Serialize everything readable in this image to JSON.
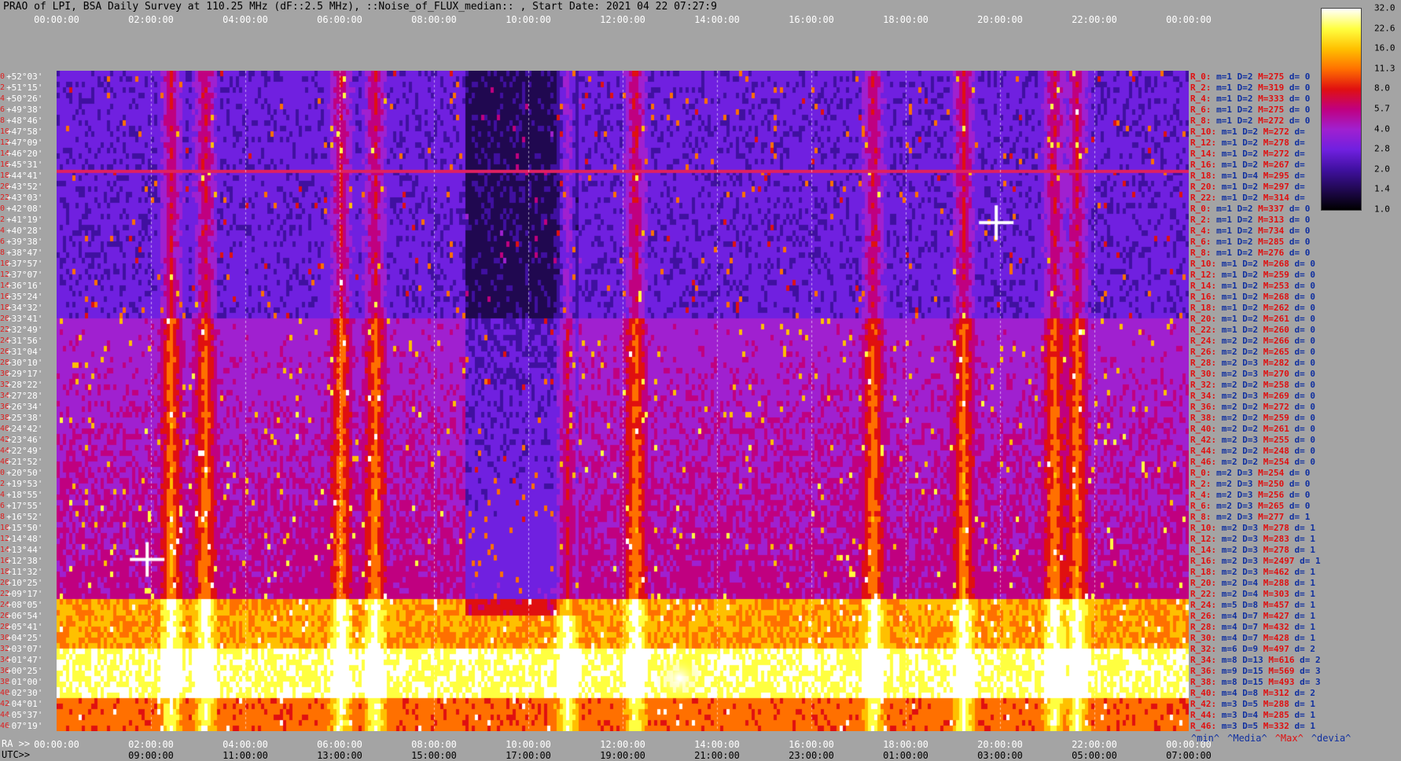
{
  "title": "PRAO of LPI, BSA Daily Survey at 110.25 MHz (dF::2.5 MHz), ::Noise_of_FLUX_median:: , Start Date: 2021 04 22 07:27:9",
  "chart_data": {
    "type": "heatmap",
    "title": "PRAO of LPI, BSA Daily Survey at 110.25 MHz (dF::2.5 MHz), ::Noise_of_FLUX_median:: , Start Date: 2021 04 22 07:27:9",
    "x_top_ticks": [
      "00:00:00",
      "02:00:00",
      "04:00:00",
      "06:00:00",
      "08:00:00",
      "10:00:00",
      "12:00:00",
      "14:00:00",
      "16:00:00",
      "18:00:00",
      "20:00:00",
      "22:00:00",
      "00:00:00"
    ],
    "x_ra_prefix": "RA >>",
    "x_ra_ticks": [
      "00:00:00",
      "02:00:00",
      "04:00:00",
      "06:00:00",
      "08:00:00",
      "10:00:00",
      "12:00:00",
      "14:00:00",
      "16:00:00",
      "18:00:00",
      "20:00:00",
      "22:00:00",
      "00:00:00"
    ],
    "x_utc_prefix": "UTC>>",
    "x_utc_ticks": [
      "09:00:00",
      "11:00:00",
      "13:00:00",
      "15:00:00",
      "17:00:00",
      "19:00:00",
      "21:00:00",
      "23:00:00",
      "01:00:00",
      "03:00:00",
      "05:00:00",
      "07:00:00"
    ],
    "y_dec_ticks": [
      "+52°03'",
      "+51°15'",
      "+50°26'",
      "+49°38'",
      "+48°46'",
      "+47°58'",
      "+47°09'",
      "+46°20'",
      "+45°31'",
      "+44°41'",
      "+43°52'",
      "+43°03'",
      "+42°08'",
      "+41°19'",
      "+40°28'",
      "+39°38'",
      "+38°47'",
      "+37°57'",
      "+37°07'",
      "+36°16'",
      "+35°24'",
      "+34°32'",
      "+33°41'",
      "+32°49'",
      "+31°56'",
      "+31°04'",
      "+30°10'",
      "+29°17'",
      "+28°22'",
      "+27°28'",
      "+26°34'",
      "+25°38'",
      "+24°42'",
      "+23°46'",
      "+22°49'",
      "+21°52'",
      "+20°50'",
      "+19°53'",
      "+18°55'",
      "+17°55'",
      "+16°52'",
      "+15°50'",
      "+14°48'",
      "+13°44'",
      "+12°38'",
      "+11°32'",
      "+10°25'",
      "+09°17'",
      "+08°05'",
      "+06°54'",
      "+05°41'",
      "+04°25'",
      "+03°07'",
      "+01°47'",
      "+00°25'",
      "-01°00'",
      "-02°30'",
      "-04°01'",
      "-05°37'",
      "-07°19'"
    ],
    "y_index": [
      "0",
      "2",
      "4",
      "6",
      "8",
      "10",
      "12",
      "14",
      "16",
      "18",
      "20",
      "22",
      "0",
      "2",
      "4",
      "6",
      "8",
      "10",
      "12",
      "14",
      "16",
      "18",
      "20",
      "22",
      "24",
      "26",
      "28",
      "30",
      "32",
      "34",
      "36",
      "38",
      "40",
      "42",
      "44",
      "46",
      "0",
      "2",
      "4",
      "6",
      "8",
      "10",
      "12",
      "14",
      "16",
      "18",
      "20",
      "22",
      "24",
      "26",
      "28",
      "30",
      "32",
      "34",
      "36",
      "38",
      "40",
      "42",
      "44",
      "46"
    ],
    "colorbar": {
      "ticks": [
        "32.0",
        "22.6",
        "16.0",
        "11.3",
        "8.0",
        "5.7",
        "4.0",
        "2.8",
        "2.0",
        "1.4",
        "1.0"
      ],
      "scale": "log",
      "colormap": [
        "#ffffff",
        "#ffff40",
        "#ffc000",
        "#ff7000",
        "#e01010",
        "#c00080",
        "#a020d0",
        "#7020e0",
        "#4010a0",
        "#200850",
        "#000000"
      ]
    },
    "right_labels": [
      {
        "r": "R_0:",
        "m": "m=1",
        "D": "D=2",
        "M": "M=275",
        "d": "d= 0"
      },
      {
        "r": "R_2:",
        "m": "m=1",
        "D": "D=2",
        "M": "M=319",
        "d": "d= 0"
      },
      {
        "r": "R_4:",
        "m": "m=1",
        "D": "D=2",
        "M": "M=333",
        "d": "d= 0"
      },
      {
        "r": "R_6:",
        "m": "m=1",
        "D": "D=2",
        "M": "M=275",
        "d": "d= 0"
      },
      {
        "r": "R_8:",
        "m": "m=1",
        "D": "D=2",
        "M": "M=272",
        "d": "d= 0"
      },
      {
        "r": "R_10:",
        "m": "m=1",
        "D": "D=2",
        "M": "M=272",
        "d": "d="
      },
      {
        "r": "R_12:",
        "m": "m=1",
        "D": "D=2",
        "M": "M=278",
        "d": "d="
      },
      {
        "r": "R_14:",
        "m": "m=1",
        "D": "D=2",
        "M": "M=272",
        "d": "d="
      },
      {
        "r": "R_16:",
        "m": "m=1",
        "D": "D=2",
        "M": "M=267",
        "d": "d="
      },
      {
        "r": "R_18:",
        "m": "m=1",
        "D": "D=4",
        "M": "M=295",
        "d": "d="
      },
      {
        "r": "R_20:",
        "m": "m=1",
        "D": "D=2",
        "M": "M=297",
        "d": "d="
      },
      {
        "r": "R_22:",
        "m": "m=1",
        "D": "D=2",
        "M": "M=314",
        "d": "d="
      },
      {
        "r": "R_0:",
        "m": "m=1",
        "D": "D=2",
        "M": "M=337",
        "d": "d= 0"
      },
      {
        "r": "R_2:",
        "m": "m=1",
        "D": "D=2",
        "M": "M=313",
        "d": "d= 0"
      },
      {
        "r": "R_4:",
        "m": "m=1",
        "D": "D=2",
        "M": "M=734",
        "d": "d= 0"
      },
      {
        "r": "R_6:",
        "m": "m=1",
        "D": "D=2",
        "M": "M=285",
        "d": "d= 0"
      },
      {
        "r": "R_8:",
        "m": "m=1",
        "D": "D=2",
        "M": "M=276",
        "d": "d= 0"
      },
      {
        "r": "R_10:",
        "m": "m=1",
        "D": "D=2",
        "M": "M=268",
        "d": "d= 0"
      },
      {
        "r": "R_12:",
        "m": "m=1",
        "D": "D=2",
        "M": "M=259",
        "d": "d= 0"
      },
      {
        "r": "R_14:",
        "m": "m=1",
        "D": "D=2",
        "M": "M=253",
        "d": "d= 0"
      },
      {
        "r": "R_16:",
        "m": "m=1",
        "D": "D=2",
        "M": "M=268",
        "d": "d= 0"
      },
      {
        "r": "R_18:",
        "m": "m=1",
        "D": "D=2",
        "M": "M=262",
        "d": "d= 0"
      },
      {
        "r": "R_20:",
        "m": "m=1",
        "D": "D=2",
        "M": "M=261",
        "d": "d= 0"
      },
      {
        "r": "R_22:",
        "m": "m=1",
        "D": "D=2",
        "M": "M=260",
        "d": "d= 0"
      },
      {
        "r": "R_24:",
        "m": "m=2",
        "D": "D=2",
        "M": "M=266",
        "d": "d= 0"
      },
      {
        "r": "R_26:",
        "m": "m=2",
        "D": "D=2",
        "M": "M=265",
        "d": "d= 0"
      },
      {
        "r": "R_28:",
        "m": "m=2",
        "D": "D=3",
        "M": "M=282",
        "d": "d= 0"
      },
      {
        "r": "R_30:",
        "m": "m=2",
        "D": "D=3",
        "M": "M=270",
        "d": "d= 0"
      },
      {
        "r": "R_32:",
        "m": "m=2",
        "D": "D=2",
        "M": "M=258",
        "d": "d= 0"
      },
      {
        "r": "R_34:",
        "m": "m=2",
        "D": "D=3",
        "M": "M=269",
        "d": "d= 0"
      },
      {
        "r": "R_36:",
        "m": "m=2",
        "D": "D=2",
        "M": "M=272",
        "d": "d= 0"
      },
      {
        "r": "R_38:",
        "m": "m=2",
        "D": "D=2",
        "M": "M=259",
        "d": "d= 0"
      },
      {
        "r": "R_40:",
        "m": "m=2",
        "D": "D=2",
        "M": "M=261",
        "d": "d= 0"
      },
      {
        "r": "R_42:",
        "m": "m=2",
        "D": "D=3",
        "M": "M=255",
        "d": "d= 0"
      },
      {
        "r": "R_44:",
        "m": "m=2",
        "D": "D=2",
        "M": "M=248",
        "d": "d= 0"
      },
      {
        "r": "R_46:",
        "m": "m=2",
        "D": "D=2",
        "M": "M=254",
        "d": "d= 0"
      },
      {
        "r": "R_0:",
        "m": "m=2",
        "D": "D=3",
        "M": "M=254",
        "d": "d= 0"
      },
      {
        "r": "R_2:",
        "m": "m=2",
        "D": "D=3",
        "M": "M=250",
        "d": "d= 0"
      },
      {
        "r": "R_4:",
        "m": "m=2",
        "D": "D=3",
        "M": "M=256",
        "d": "d= 0"
      },
      {
        "r": "R_6:",
        "m": "m=2",
        "D": "D=3",
        "M": "M=265",
        "d": "d= 0"
      },
      {
        "r": "R_8:",
        "m": "m=2",
        "D": "D=3",
        "M": "M=277",
        "d": "d= 1"
      },
      {
        "r": "R_10:",
        "m": "m=2",
        "D": "D=3",
        "M": "M=278",
        "d": "d= 1"
      },
      {
        "r": "R_12:",
        "m": "m=2",
        "D": "D=3",
        "M": "M=283",
        "d": "d= 1"
      },
      {
        "r": "R_14:",
        "m": "m=2",
        "D": "D=3",
        "M": "M=278",
        "d": "d= 1"
      },
      {
        "r": "R_16:",
        "m": "m=2",
        "D": "D=3",
        "M": "M=2497",
        "d": "d= 1"
      },
      {
        "r": "R_18:",
        "m": "m=2",
        "D": "D=3",
        "M": "M=462",
        "d": "d= 1"
      },
      {
        "r": "R_20:",
        "m": "m=2",
        "D": "D=4",
        "M": "M=288",
        "d": "d= 1"
      },
      {
        "r": "R_22:",
        "m": "m=2",
        "D": "D=4",
        "M": "M=303",
        "d": "d= 1"
      },
      {
        "r": "R_24:",
        "m": "m=5",
        "D": "D=8",
        "M": "M=457",
        "d": "d= 1"
      },
      {
        "r": "R_26:",
        "m": "m=4",
        "D": "D=7",
        "M": "M=427",
        "d": "d= 1"
      },
      {
        "r": "R_28:",
        "m": "m=4",
        "D": "D=7",
        "M": "M=432",
        "d": "d= 1"
      },
      {
        "r": "R_30:",
        "m": "m=4",
        "D": "D=7",
        "M": "M=428",
        "d": "d= 1"
      },
      {
        "r": "R_32:",
        "m": "m=6",
        "D": "D=9",
        "M": "M=497",
        "d": "d= 2"
      },
      {
        "r": "R_34:",
        "m": "m=8",
        "D": "D=13",
        "M": "M=616",
        "d": "d= 2"
      },
      {
        "r": "R_36:",
        "m": "m=9",
        "D": "D=15",
        "M": "M=569",
        "d": "d= 3"
      },
      {
        "r": "R_38:",
        "m": "m=8",
        "D": "D=15",
        "M": "M=493",
        "d": "d= 3"
      },
      {
        "r": "R_40:",
        "m": "m=4",
        "D": "D=8",
        "M": "M=312",
        "d": "d= 2"
      },
      {
        "r": "R_42:",
        "m": "m=3",
        "D": "D=5",
        "M": "M=288",
        "d": "d= 1"
      },
      {
        "r": "R_44:",
        "m": "m=3",
        "D": "D=4",
        "M": "M=285",
        "d": "d= 1"
      },
      {
        "r": "R_46:",
        "m": "m=3",
        "D": "D=5",
        "M": "M=332",
        "d": "d= 1"
      }
    ],
    "legend": [
      {
        "label": "^min^",
        "color": "#1030a0"
      },
      {
        "label": "^Media^",
        "color": "#1030a0"
      },
      {
        "label": "^Max^",
        "color": "#e01010"
      },
      {
        "label": "^devia^",
        "color": "#1030a0"
      }
    ]
  }
}
